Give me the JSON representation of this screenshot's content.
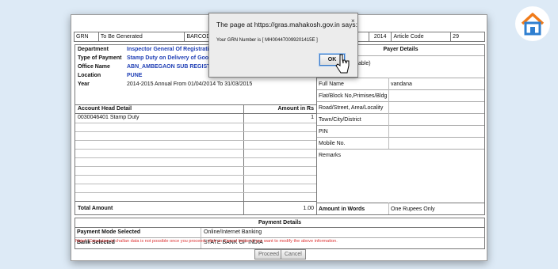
{
  "topbar": {
    "grn_label": "GRN",
    "grn_value": "To Be Generated",
    "barcode_label": "BARCOD",
    "date_value": "2014",
    "article_label": "Article Code",
    "article_value": "29"
  },
  "details": [
    {
      "label": "Department",
      "value": "Inspector General Of Registration"
    },
    {
      "label": "Type of Payment",
      "value": "Stamp Duty on Delivery of Goods"
    },
    {
      "label": "Office Name",
      "value": "ABN_AMBEGAON SUB REGISTRAR"
    },
    {
      "label": "Location",
      "value": "PUNE"
    },
    {
      "label": "Year",
      "value": "2014-2015      Annual From 01/04/2014 To 31/03/2015"
    }
  ],
  "account": {
    "head_label": "Account Head Detail",
    "amount_label": "Amount in Rs",
    "row_head": "0030046401   Stamp Duty",
    "row_amount": "1",
    "total_label": "Total Amount",
    "total_value": "1.00"
  },
  "payer": {
    "title": "Payer Details",
    "applicable_text": "able)",
    "full_name_label": "Full Name",
    "full_name_value": "vandana",
    "flat_label": "Flat/Block No,Primises/Bldg",
    "road_label": "Road/Street, Area/Locality",
    "town_label": "Town/City/District",
    "pin_label": "PIN",
    "mobile_label": "Mobile No.",
    "remarks_label": "Remarks",
    "words_label": "Amount in Words",
    "words_value": "One Rupees Only"
  },
  "payment": {
    "title": "Payment Details",
    "mode_label": "Payment Mode Selected",
    "mode_value": "Online/Internet Banking",
    "bank_label": "Bank Selected",
    "bank_value": "STATE BANK OF INDIA"
  },
  "note": "Note*: Correction in challan data is not possible once you proceed, click on Cancel button if you want to modify the above information.",
  "buttons": {
    "proceed": "Proceed",
    "cancel": "Cancel"
  },
  "dialog": {
    "title": "The page at https://gras.mahakosh.gov.in says:",
    "close": "×",
    "message": "Your GRN Number is [ MH004470099201415E ]",
    "ok": "OK"
  },
  "colors": {
    "accent_orange": "#f07b1a",
    "accent_blue": "#2f7fd0",
    "link_blue": "#1f3fb5"
  }
}
